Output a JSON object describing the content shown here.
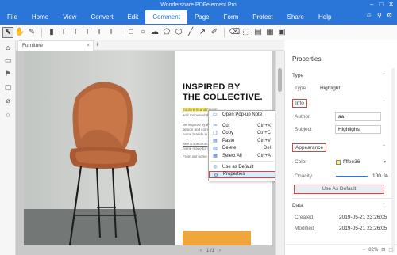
{
  "window": {
    "title": "Wondershare PDFelement Pro",
    "controls": [
      "–",
      "□",
      "✕"
    ]
  },
  "menu": {
    "items": [
      "File",
      "Home",
      "View",
      "Convert",
      "Edit",
      "Comment",
      "Page",
      "Form",
      "Protect",
      "Share",
      "Help"
    ],
    "active": "Comment"
  },
  "doc": {
    "tab_name": "Furniture",
    "heading_line1": "INSPIRED BY",
    "heading_line2": "THE COLLECTIVE.",
    "highlight_text": "Explore Scandinavian",
    "body_lines": [
      "and renowned de",
      "Be inspired by th",
      "design and comfo",
      "home brands in o",
      "See a spectrum",
      "home made for liv",
      "From our home"
    ],
    "page_nav": "1 /1"
  },
  "context_menu": {
    "items": [
      {
        "label": "Open Pop-up Note",
        "shortcut": "",
        "icon": "note-icon"
      },
      {
        "label": "Cut",
        "shortcut": "Ctrl+X",
        "icon": "scissors-icon"
      },
      {
        "label": "Copy",
        "shortcut": "Ctrl+C",
        "icon": "copy-icon"
      },
      {
        "label": "Paste",
        "shortcut": "Ctrl+V",
        "icon": "paste-icon"
      },
      {
        "label": "Delete",
        "shortcut": "Del",
        "icon": "trash-icon"
      },
      {
        "label": "Select All",
        "shortcut": "Ctrl+A",
        "icon": "select-all-icon"
      },
      {
        "label": "Use as Default",
        "shortcut": "",
        "icon": "default-icon"
      },
      {
        "label": "Properties",
        "shortcut": "",
        "icon": "properties-icon"
      }
    ],
    "highlighted": "Properties"
  },
  "properties": {
    "title": "Properties",
    "type_section": "Type",
    "type_label": "Type",
    "type_value": "Highlight",
    "info_section": "Info",
    "author_label": "Author",
    "author_value": "aa",
    "subject_label": "Subject",
    "subject_value": "Highlighs",
    "appearance_section": "Appearance",
    "color_label": "Color",
    "color_value": "ffffee36",
    "color_hex": "#fff36f",
    "opacity_label": "Opacity",
    "opacity_value": "100",
    "opacity_unit": "%",
    "use_default_label": "Use As Default",
    "data_section": "Data",
    "created_label": "Created",
    "created_value": "2019-05-21 23:26:05",
    "modified_label": "Modified",
    "modified_value": "2019-05-21 23:26:05",
    "zoom_value": "82%"
  },
  "colors": {
    "accent": "#2a75d8",
    "highlight_box": "#d64545",
    "orange": "#f0a63a"
  }
}
